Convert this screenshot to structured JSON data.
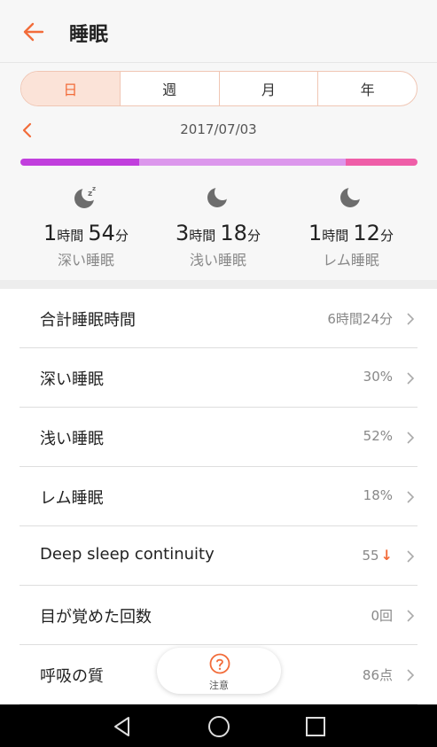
{
  "header": {
    "title": "睡眠",
    "back_icon": "back-arrow-icon"
  },
  "period_tabs": [
    {
      "label": "日",
      "active": true
    },
    {
      "label": "週",
      "active": false
    },
    {
      "label": "月",
      "active": false
    },
    {
      "label": "年",
      "active": false
    }
  ],
  "date": {
    "label": "2017/07/03",
    "prev_icon": "chevron-left-icon"
  },
  "sleep_bar": {
    "segments": [
      {
        "stage": "深い睡眠",
        "color": "#c13fdd",
        "fraction": 0.3
      },
      {
        "stage": "浅い睡眠",
        "color": "#dc97ec",
        "fraction": 0.52
      },
      {
        "stage": "レム睡眠",
        "color": "#ef5ea8",
        "fraction": 0.18
      }
    ]
  },
  "stages": [
    {
      "icon": "moon-zzz-icon",
      "hours": "1",
      "hours_unit": "時間",
      "minutes": "54",
      "minutes_unit": "分",
      "label": "深い睡眠"
    },
    {
      "icon": "moon-icon",
      "hours": "3",
      "hours_unit": "時間",
      "minutes": "18",
      "minutes_unit": "分",
      "label": "浅い睡眠"
    },
    {
      "icon": "moon-icon",
      "hours": "1",
      "hours_unit": "時間",
      "minutes": "12",
      "minutes_unit": "分",
      "label": "レム睡眠"
    }
  ],
  "metrics": [
    {
      "label": "合計睡眠時間",
      "value": "6時間24分"
    },
    {
      "label": "深い睡眠",
      "value": "30%"
    },
    {
      "label": "浅い睡眠",
      "value": "52%"
    },
    {
      "label": "レム睡眠",
      "value": "18%"
    },
    {
      "label": "Deep sleep continuity",
      "value": "55",
      "trend": "down",
      "trend_symbol": "↓"
    },
    {
      "label": "目が覚めた回数",
      "value": "0回"
    },
    {
      "label": "呼吸の質",
      "value": "86点"
    }
  ],
  "fab": {
    "label": "注意",
    "icon": "question-circle-icon"
  },
  "navbar": {
    "icons": [
      "nav-back-icon",
      "nav-home-icon",
      "nav-recents-icon"
    ]
  },
  "colors": {
    "accent": "#f26c3a",
    "deep": "#c13fdd",
    "light": "#dc97ec",
    "rem": "#ef5ea8"
  }
}
